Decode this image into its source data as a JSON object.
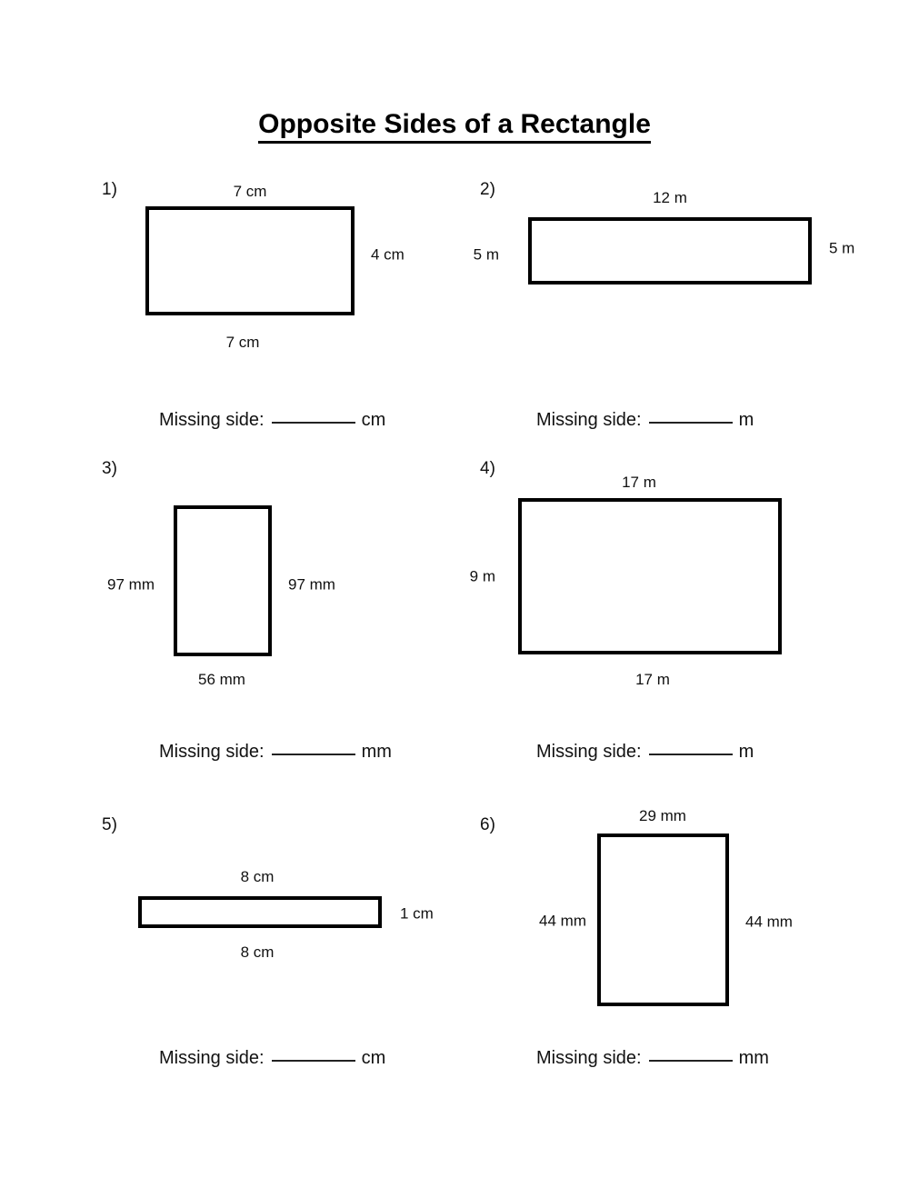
{
  "page": {
    "title": "Opposite Sides of a Rectangle",
    "background_color": "#ffffff",
    "ink_color": "#000000"
  },
  "missing_side_prompt": "Missing side:",
  "problems": [
    {
      "number": "1)",
      "top": "7 cm",
      "right": "4 cm",
      "bottom": "7 cm",
      "left": "",
      "missing_position": "left",
      "unit": "cm",
      "answer_blank": "________"
    },
    {
      "number": "2)",
      "top": "12 m",
      "right": "5 m",
      "bottom": "",
      "left": "5 m",
      "missing_position": "bottom",
      "unit": "m",
      "answer_blank": "________"
    },
    {
      "number": "3)",
      "top": "",
      "right": "97 mm",
      "bottom": "56 mm",
      "left": "97 mm",
      "missing_position": "top",
      "unit": "mm",
      "answer_blank": "________"
    },
    {
      "number": "4)",
      "top": "17 m",
      "right": "",
      "bottom": "17 m",
      "left": "9 m",
      "missing_position": "right",
      "unit": "m",
      "answer_blank": "________"
    },
    {
      "number": "5)",
      "top": "8 cm",
      "right": "1 cm",
      "bottom": "8 cm",
      "left": "",
      "missing_position": "left",
      "unit": "cm",
      "answer_blank": "________"
    },
    {
      "number": "6)",
      "top": "29 mm",
      "right": "44 mm",
      "bottom": "",
      "left": "44 mm",
      "missing_position": "bottom",
      "unit": "mm",
      "answer_blank": "________"
    }
  ]
}
